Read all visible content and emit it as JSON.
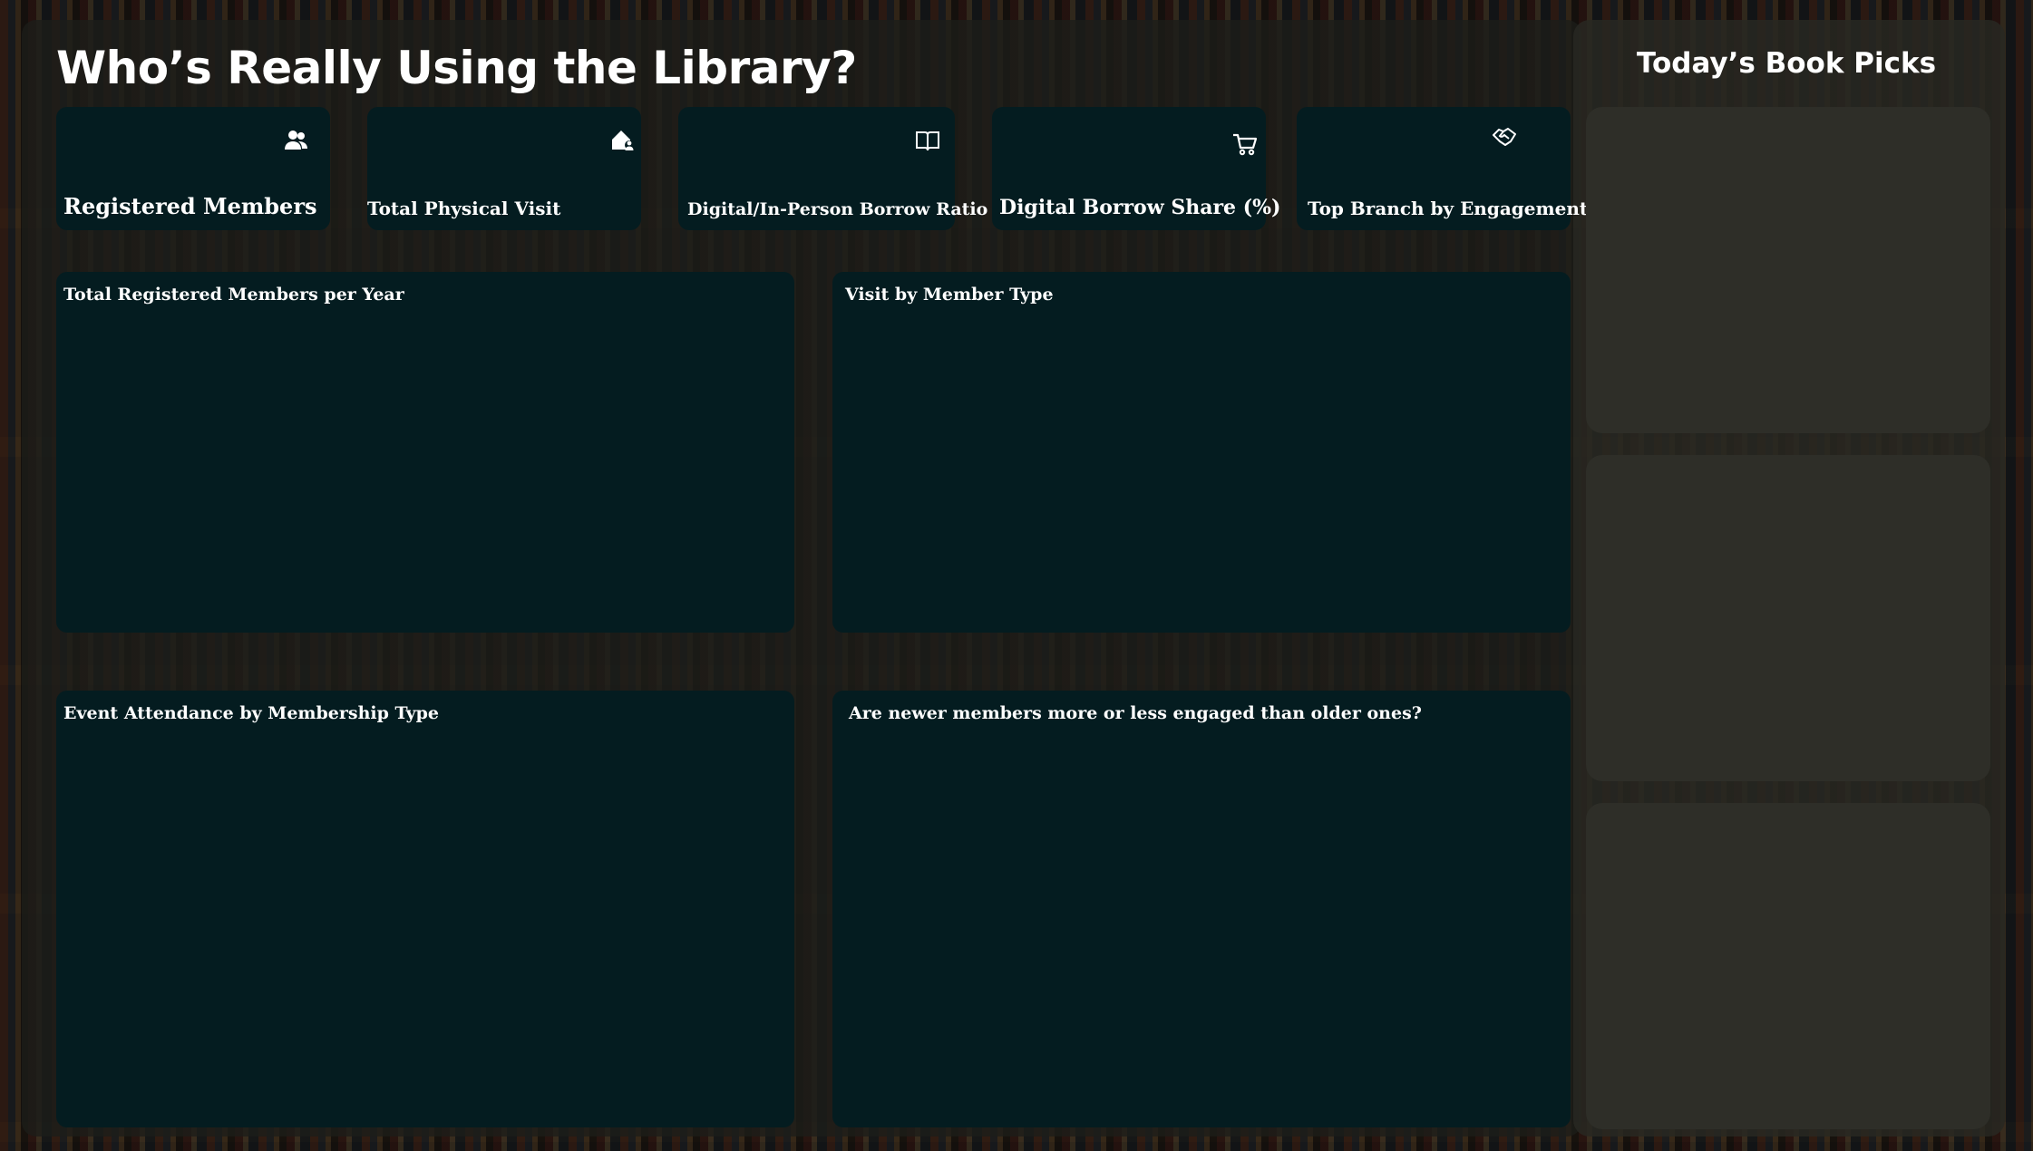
{
  "header": {
    "title": "Who’s Really Using the Library?"
  },
  "sidebar": {
    "title": "Today’s Book Picks",
    "book_cards": [
      {},
      {},
      {}
    ]
  },
  "kpis": [
    {
      "label": "Registered Members",
      "icon": "users-icon"
    },
    {
      "label": "Total Physical Visit",
      "icon": "house-user-icon"
    },
    {
      "label": "Digital/In-Person Borrow Ratio",
      "icon": "open-book-icon"
    },
    {
      "label": "Digital Borrow Share (%)",
      "icon": "cart-icon"
    },
    {
      "label": "Top Branch by Engagement",
      "icon": "handshake-icon"
    }
  ],
  "charts": {
    "members_per_year": {
      "title": "Total Registered Members per Year"
    },
    "visit_by_member_type": {
      "title": "Visit by Member Type"
    },
    "event_attendance": {
      "title": "Event Attendance by Membership Type"
    },
    "engagement_newer_older": {
      "title": "Are newer members more or less engaged than older ones?"
    }
  },
  "colors": {
    "card_bg": "#041c20",
    "book_card_bg": "#2e2e28",
    "text": "#ffffff"
  }
}
